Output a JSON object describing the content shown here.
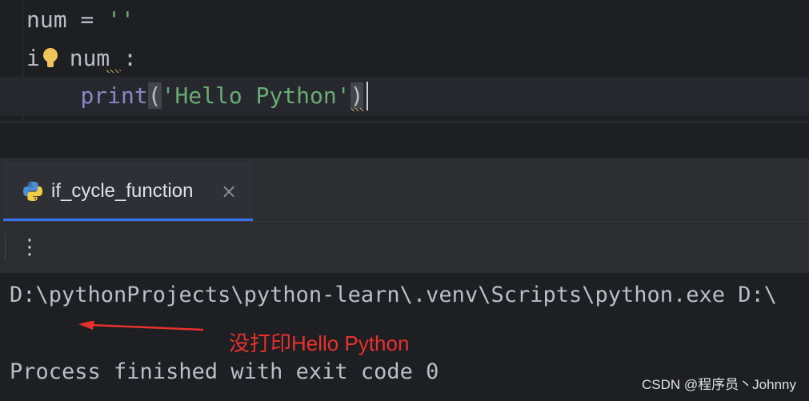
{
  "editor": {
    "lines": [
      {
        "a": "num ",
        "b": "= ",
        "c": "''"
      },
      {
        "kw_first": "i",
        "kw_rest": "f",
        "b": " num",
        "c": " :"
      },
      {
        "indent": "    ",
        "fn": "print",
        "open": "(",
        "str": "'Hello Python'",
        "close": ")"
      }
    ]
  },
  "run_panel": {
    "tab": {
      "label": "if_cycle_function",
      "close_glyph": "×",
      "icon": "python-icon"
    },
    "toolbar": {
      "more_glyph": "⋮"
    },
    "console": {
      "command": "D:\\pythonProjects\\python-learn\\.venv\\Scripts\\python.exe D:\\",
      "exit": "Process finished with exit code 0"
    }
  },
  "annotation": {
    "text": "没打印Hello Python",
    "color": "#e8312e"
  },
  "watermark": "CSDN @程序员丶Johnny",
  "colors": {
    "accent": "#3574f0",
    "string": "#6aab73",
    "builtin": "#8888c6",
    "keyword": "#cf8e6d"
  }
}
